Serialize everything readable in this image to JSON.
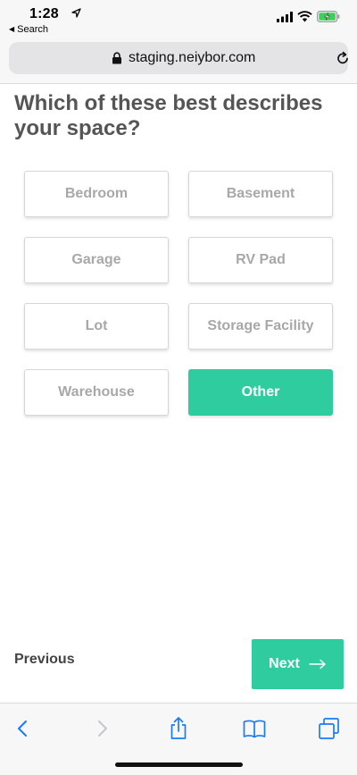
{
  "status_bar": {
    "time": "1:28",
    "back_app_label": "Search"
  },
  "browser": {
    "url": "staging.neiybor.com"
  },
  "page": {
    "question": "Which of these best describes your space?",
    "options": [
      {
        "label": "Bedroom",
        "selected": false
      },
      {
        "label": "Basement",
        "selected": false
      },
      {
        "label": "Garage",
        "selected": false
      },
      {
        "label": "RV Pad",
        "selected": false
      },
      {
        "label": "Lot",
        "selected": false
      },
      {
        "label": "Storage Facility",
        "selected": false
      },
      {
        "label": "Warehouse",
        "selected": false
      },
      {
        "label": "Other",
        "selected": true
      }
    ],
    "previous_label": "Previous",
    "next_label": "Next"
  },
  "colors": {
    "accent": "#2ecc9e",
    "ios_blue": "#1a7cf5",
    "heading": "#555555",
    "option_text": "#a8a8a8"
  },
  "toolbar": {
    "icons": [
      "back-icon",
      "forward-icon",
      "share-icon",
      "bookmarks-icon",
      "tabs-icon"
    ]
  }
}
